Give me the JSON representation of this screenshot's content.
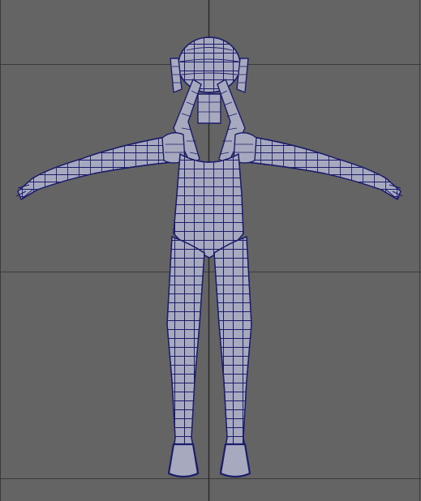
{
  "viewport": {
    "view": "front",
    "background_color": "#646464",
    "grid_color": "#3a3a3a",
    "axis_color": "#2a2a2a",
    "model": {
      "name": "character-mesh",
      "display": "wireframe-on-shaded",
      "shaded_color": "#a7a9be",
      "wire_color": "#1c1d6a",
      "pose": "T-pose"
    }
  }
}
